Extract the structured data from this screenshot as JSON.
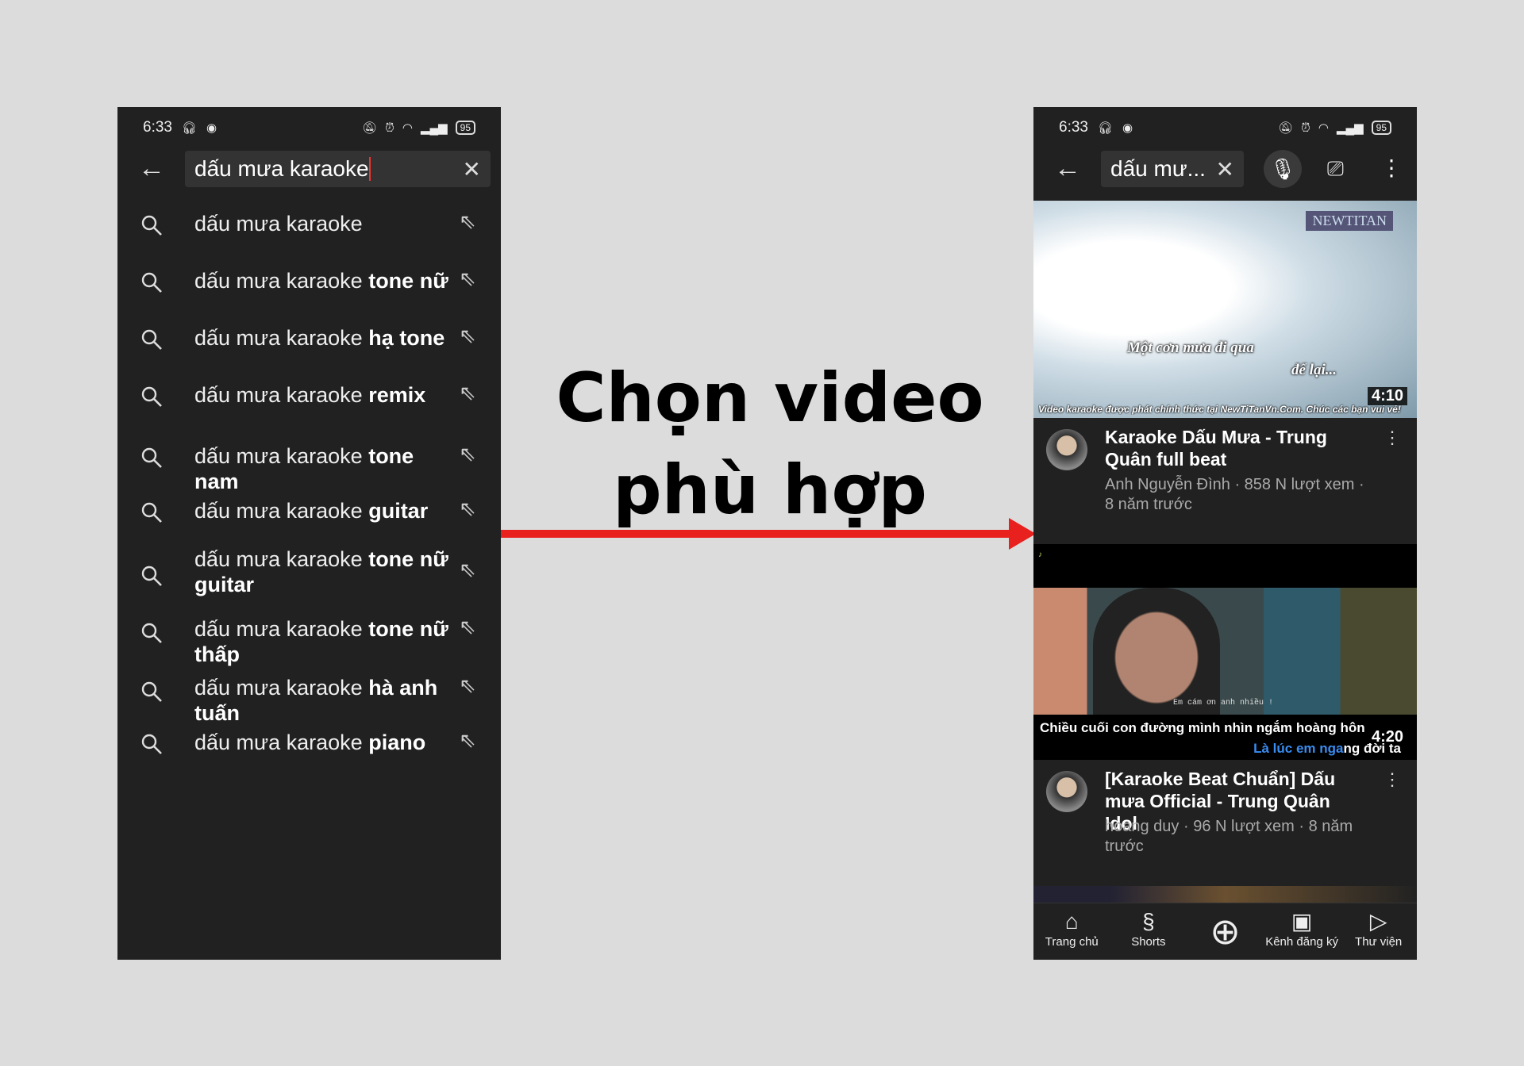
{
  "left_phone": {
    "status": {
      "time": "6:33",
      "battery": "95"
    },
    "search": {
      "value": "dấu mưa karaoke"
    },
    "suggestions": [
      {
        "base": "dấu mưa karaoke",
        "bold": ""
      },
      {
        "base": "dấu mưa karaoke ",
        "bold": "tone nữ"
      },
      {
        "base": "dấu mưa karaoke ",
        "bold": "hạ tone"
      },
      {
        "base": "dấu mưa karaoke ",
        "bold": "remix"
      },
      {
        "base": "dấu mưa karaoke ",
        "bold": "tone nam"
      },
      {
        "base": "dấu mưa karaoke ",
        "bold": "guitar"
      },
      {
        "base": "dấu mưa karaoke ",
        "bold": "tone nữ guitar"
      },
      {
        "base": "dấu mưa karaoke ",
        "bold": "tone nữ thấp"
      },
      {
        "base": "dấu mưa karaoke ",
        "bold": "hà anh tuấn"
      },
      {
        "base": "dấu mưa karaoke ",
        "bold": "piano"
      }
    ]
  },
  "annotation": {
    "line1": "Chọn video",
    "line2": "phù hợp",
    "arrow_color": "#e8211f"
  },
  "right_phone": {
    "status": {
      "time": "6:33",
      "battery": "95"
    },
    "search": {
      "value": "dấu mư..."
    },
    "videos": [
      {
        "title": "Karaoke Dấu Mưa - Trung Quân full beat",
        "meta": "Anh Nguyễn Đình · 858 N lượt xem · 8 năm trước",
        "duration": "4:10",
        "thumb_lyric1": "Một cơn mưa đi qua",
        "thumb_lyric2": "để lại...",
        "thumb_footer": "Video karaoke được phát chính thức tại NewTiTanVn.Com. Chúc các bạn vui vẻ!",
        "thumb_logo": "NEWTITAN"
      },
      {
        "title": "[Karaoke Beat Chuẩn] Dấu mưa Official - Trung Quân Idol",
        "meta": "hoang duy · 96 N lượt xem · 8 năm trước",
        "duration": "4:20",
        "thumb_sub": "Em cám ơn anh nhiều !",
        "thumb_lyric1": "Chiều cuối con đường mình nhìn ngắm hoàng hôn",
        "thumb_lyric2_hl": "Là lúc em nga",
        "thumb_lyric2_rest": "ng đời ta"
      }
    ],
    "nav": [
      {
        "label": "Trang chủ",
        "icon": "home-icon"
      },
      {
        "label": "Shorts",
        "icon": "shorts-icon"
      },
      {
        "label": "",
        "icon": "create-icon"
      },
      {
        "label": "Kênh đăng ký",
        "icon": "subscriptions-icon"
      },
      {
        "label": "Thư viện",
        "icon": "library-icon"
      }
    ]
  }
}
